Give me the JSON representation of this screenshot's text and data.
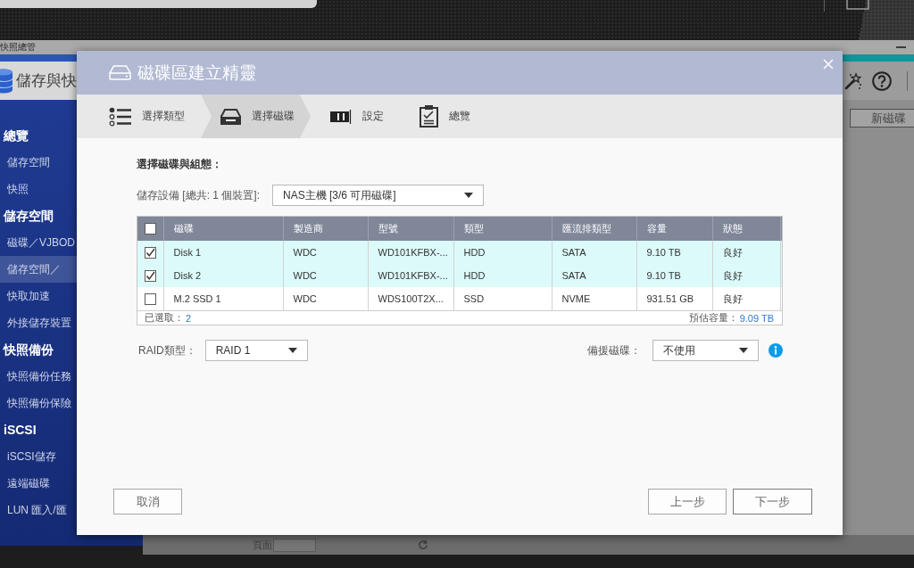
{
  "background_app": {
    "window_title": "快照總管",
    "app_title": "儲存與快",
    "sidebar": {
      "items": [
        {
          "kind": "header",
          "label": "總覽",
          "selected": false
        },
        {
          "kind": "item",
          "label": "儲存空間",
          "selected": false
        },
        {
          "kind": "item",
          "label": "快照",
          "selected": false
        },
        {
          "kind": "header",
          "label": "儲存空間",
          "selected": false
        },
        {
          "kind": "item",
          "label": "磁碟／VJBOD",
          "selected": false
        },
        {
          "kind": "item",
          "label": "儲存空間／",
          "selected": true
        },
        {
          "kind": "item",
          "label": "快取加速",
          "selected": false
        },
        {
          "kind": "item",
          "label": "外接儲存裝置",
          "selected": false
        },
        {
          "kind": "header",
          "label": "快照備份",
          "selected": false
        },
        {
          "kind": "item",
          "label": "快照備份任務",
          "selected": false
        },
        {
          "kind": "item",
          "label": "快照備份保險",
          "selected": false
        },
        {
          "kind": "header",
          "label": "iSCSI",
          "selected": false
        },
        {
          "kind": "item",
          "label": "iSCSI儲存",
          "selected": false
        },
        {
          "kind": "item",
          "label": "遠端磁碟",
          "selected": false
        },
        {
          "kind": "item",
          "label": "LUN 匯入/匯",
          "selected": false
        }
      ]
    },
    "new_volume_button": "新磁碟",
    "pager": {
      "label": "頁面"
    }
  },
  "wizard": {
    "title": "磁碟區建立精靈",
    "steps": [
      {
        "label": "選擇類型",
        "selected": false
      },
      {
        "label": "選擇磁碟",
        "selected": true
      },
      {
        "label": "設定",
        "selected": false
      },
      {
        "label": "總覽",
        "selected": false
      }
    ],
    "section_title": "選擇磁碟與組態：",
    "storage_device": {
      "label": "儲存設備 [總共: 1 個裝置]:",
      "value": "NAS主機 [3/6 可用磁碟]"
    },
    "table": {
      "select_all_checked": false,
      "columns": [
        "磁碟",
        "製造商",
        "型號",
        "類型",
        "匯流排類型",
        "容量",
        "狀態"
      ],
      "rows": [
        {
          "checked": true,
          "cells": [
            "Disk 1",
            "WDC",
            "WD101KFBX-...",
            "HDD",
            "SATA",
            "9.10 TB",
            "良好"
          ]
        },
        {
          "checked": true,
          "cells": [
            "Disk 2",
            "WDC",
            "WD101KFBX-...",
            "HDD",
            "SATA",
            "9.10 TB",
            "良好"
          ]
        },
        {
          "checked": false,
          "cells": [
            "M.2 SSD 1",
            "WDC",
            "WDS100T2X...",
            "SSD",
            "NVME",
            "931.51 GB",
            "良好"
          ]
        }
      ],
      "footer": {
        "selected_label": "已選取：",
        "selected_count": "2",
        "capacity_label": "預估容量：",
        "capacity_value": "9.09 TB"
      }
    },
    "raid_type": {
      "label": "RAID類型：",
      "value": "RAID 1"
    },
    "spare_disk": {
      "label": "備援磁碟：",
      "value": "不使用"
    },
    "buttons": {
      "cancel": "取消",
      "back": "上一步",
      "next": "下一步"
    }
  }
}
